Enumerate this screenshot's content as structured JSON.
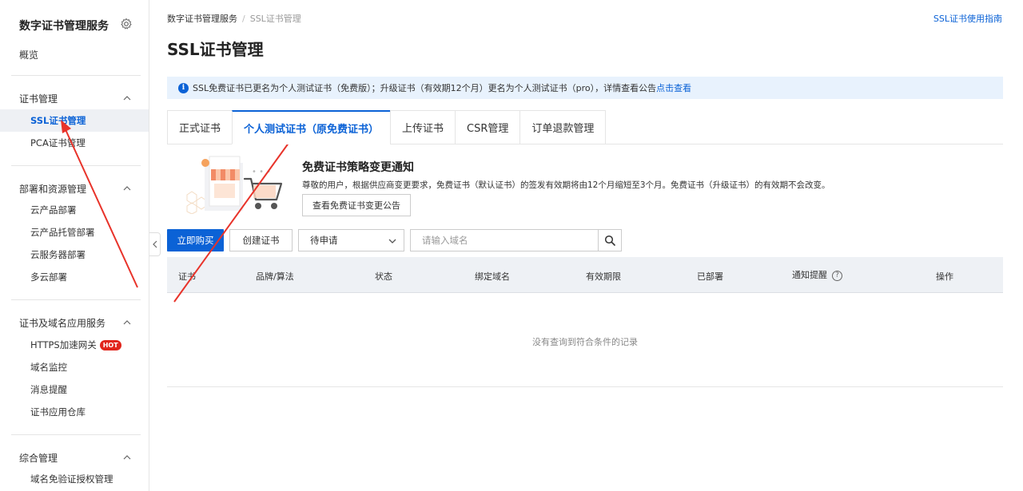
{
  "sidebar": {
    "title": "数字证书管理服务",
    "overview": "概览",
    "groups": [
      {
        "label": "证书管理",
        "items": [
          {
            "label": "SSL证书管理",
            "active": true
          },
          {
            "label": "PCA证书管理"
          }
        ]
      },
      {
        "label": "部署和资源管理",
        "items": [
          {
            "label": "云产品部署"
          },
          {
            "label": "云产品托管部署"
          },
          {
            "label": "云服务器部署"
          },
          {
            "label": "多云部署"
          }
        ]
      },
      {
        "label": "证书及域名应用服务",
        "items": [
          {
            "label": "HTTPS加速网关",
            "badge": "HOT"
          },
          {
            "label": "域名监控"
          },
          {
            "label": "消息提醒"
          },
          {
            "label": "证书应用仓库"
          }
        ]
      },
      {
        "label": "综合管理",
        "items": [
          {
            "label": "域名免验证授权管理"
          }
        ]
      }
    ]
  },
  "breadcrumb": {
    "root": "数字证书管理服务",
    "separator": "/",
    "current": "SSL证书管理"
  },
  "guide_link": "SSL证书使用指南",
  "page_title": "SSL证书管理",
  "notice": {
    "text": "SSL免费证书已更名为个人测试证书（免费版）；升级证书（有效期12个月）更名为个人测试证书（pro），详情查看公告",
    "link": "点击查看"
  },
  "tabs": [
    {
      "label": "正式证书"
    },
    {
      "label": "个人测试证书（原免费证书）",
      "active": true
    },
    {
      "label": "上传证书"
    },
    {
      "label": "CSR管理"
    },
    {
      "label": "订单退款管理"
    }
  ],
  "promo": {
    "title": "免费证书策略变更通知",
    "desc": "尊敬的用户，根据供应商变更要求，免费证书（默认证书）的签发有效期将由12个月缩短至3个月。免费证书（升级证书）的有效期不会改变。",
    "button": "查看免费证书变更公告"
  },
  "toolbar": {
    "buy": "立即购买",
    "create": "创建证书",
    "status_select": "待申请",
    "search_placeholder": "请输入域名"
  },
  "table": {
    "columns": [
      "证书",
      "品牌/算法",
      "状态",
      "绑定域名",
      "有效期限",
      "已部署",
      "通知提醒",
      "操作"
    ],
    "empty_text": "没有查询到符合条件的记录"
  },
  "colors": {
    "accent": "#0b62d6",
    "hot": "#e1251b",
    "arrow": "#e8332a"
  }
}
